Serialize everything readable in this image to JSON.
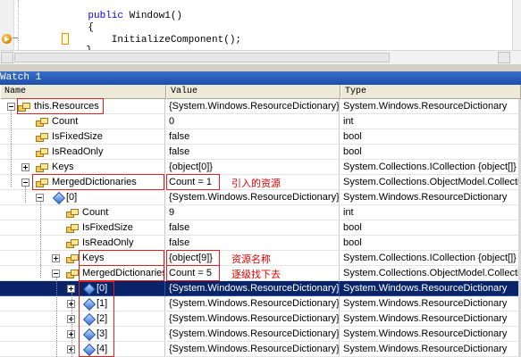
{
  "editor": {
    "lines": [
      {
        "keyword": "public",
        "rest": " Window1()"
      },
      {
        "keyword": "",
        "rest": "{"
      },
      {
        "keyword": "",
        "rest": "    InitializeComponent();"
      },
      {
        "keyword": "",
        "rest": "}"
      }
    ],
    "breakpoint_icon": "current-statement-arrow-icon"
  },
  "watch": {
    "title": "Watch 1",
    "columns": {
      "name": "Name",
      "value": "Value",
      "type": "Type"
    },
    "rows": [
      {
        "name": "this.Resources",
        "value": "{System.Windows.ResourceDictionary}",
        "type": "System.Windows.ResourceDictionary"
      },
      {
        "name": "Count",
        "value": "0",
        "type": "int"
      },
      {
        "name": "IsFixedSize",
        "value": "false",
        "type": "bool"
      },
      {
        "name": "IsReadOnly",
        "value": "false",
        "type": "bool"
      },
      {
        "name": "Keys",
        "value": "{object[0]}",
        "type": "System.Collections.ICollection {object[]}"
      },
      {
        "name": "MergedDictionaries",
        "value": "Count = 1",
        "type": "System.Collections.ObjectModel.Collectio"
      },
      {
        "name": "[0]",
        "value": "{System.Windows.ResourceDictionary}",
        "type": "System.Windows.ResourceDictionary"
      },
      {
        "name": "Count",
        "value": "9",
        "type": "int"
      },
      {
        "name": "IsFixedSize",
        "value": "false",
        "type": "bool"
      },
      {
        "name": "IsReadOnly",
        "value": "false",
        "type": "bool"
      },
      {
        "name": "Keys",
        "value": "{object[9]}",
        "type": "System.Collections.ICollection {object[]}"
      },
      {
        "name": "MergedDictionaries",
        "value": "Count = 5",
        "type": "System.Collections.ObjectModel.Collection"
      },
      {
        "name": "[0]",
        "value": "{System.Windows.ResourceDictionary}",
        "type": "System.Windows.ResourceDictionary"
      },
      {
        "name": "[1]",
        "value": "{System.Windows.ResourceDictionary}",
        "type": "System.Windows.ResourceDictionary"
      },
      {
        "name": "[2]",
        "value": "{System.Windows.ResourceDictionary}",
        "type": "System.Windows.ResourceDictionary"
      },
      {
        "name": "[3]",
        "value": "{System.Windows.ResourceDictionary}",
        "type": "System.Windows.ResourceDictionary"
      },
      {
        "name": "[4]",
        "value": "{System.Windows.ResourceDictionary}",
        "type": "System.Windows.ResourceDictionary"
      }
    ]
  },
  "annotations": {
    "imported_resources": "引入的资源",
    "resource_names": "资源名称",
    "step_down": "逐级找下去"
  },
  "colors": {
    "selection": "#0a246a",
    "annotation": "#e00000",
    "keyword": "#0000ff"
  }
}
